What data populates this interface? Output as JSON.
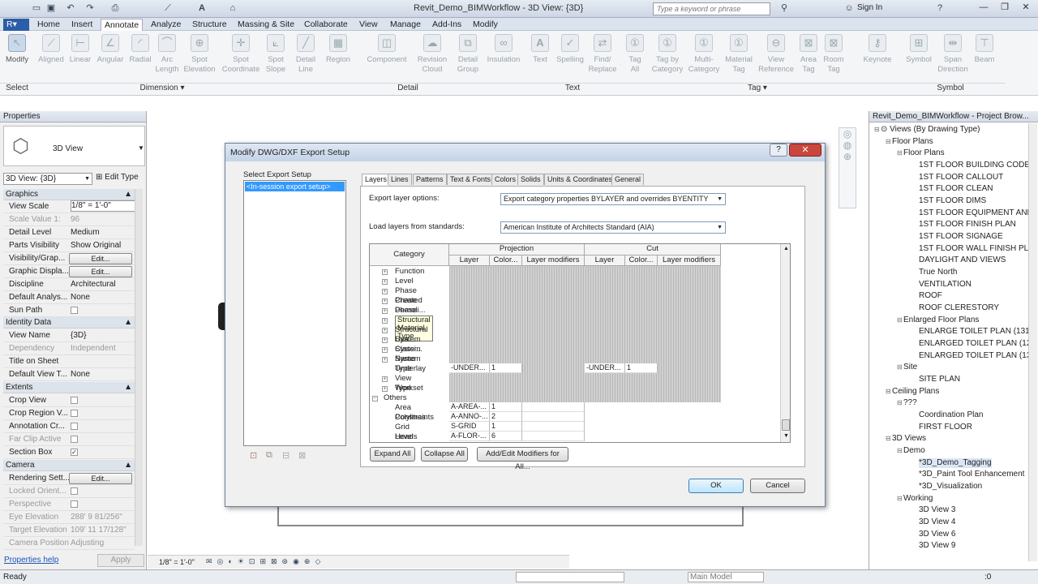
{
  "titlebar": {
    "title": "Revit_Demo_BIMWorkflow - 3D View: {3D}",
    "search_placeholder": "Type a keyword or phrase",
    "signin": "Sign In"
  },
  "tabs": [
    "Home",
    "Insert",
    "Annotate",
    "Analyze",
    "Structure",
    "Massing & Site",
    "Collaborate",
    "View",
    "Manage",
    "Add-Ins",
    "Modify"
  ],
  "active_tab": "Annotate",
  "ribbon": {
    "buttons": [
      "Modify",
      "Aligned",
      "Linear",
      "Angular",
      "Radial",
      "Arc Length",
      "Spot Elevation",
      "Spot Coordinate",
      "Spot Slope",
      "Detail Line",
      "Region",
      "Component",
      "Revision Cloud",
      "Detail Group",
      "Insulation",
      "Text",
      "Spelling",
      "Find/ Replace",
      "Tag All",
      "Tag by Category",
      "Multi- Category",
      "Material Tag",
      "View Reference",
      "Area Tag",
      "Room Tag",
      "Keynote",
      "Symbol",
      "Span Direction",
      "Beam"
    ],
    "groups": [
      "Select",
      "Dimension ▾",
      "Detail",
      "Text",
      "Tag ▾",
      "Symbol"
    ]
  },
  "properties": {
    "header": "Properties",
    "type_name": "3D View",
    "view_selector": "3D View: {3D}",
    "edit_type": "Edit Type",
    "sections": {
      "graphics": "Graphics",
      "identity": "Identity Data",
      "extents": "Extents",
      "camera": "Camera"
    },
    "rows": {
      "view_scale": [
        "View Scale",
        "1/8\" = 1'-0\""
      ],
      "scale_value": [
        "Scale Value   1:",
        "96"
      ],
      "detail_level": [
        "Detail Level",
        "Medium"
      ],
      "parts_visibility": [
        "Parts Visibility",
        "Show Original"
      ],
      "visibility": [
        "Visibility/Grap...",
        "Edit..."
      ],
      "graphic_display": [
        "Graphic Displa...",
        "Edit..."
      ],
      "discipline": [
        "Discipline",
        "Architectural"
      ],
      "default_analysis": [
        "Default Analys...",
        "None"
      ],
      "sun_path": [
        "Sun Path",
        ""
      ],
      "view_name": [
        "View Name",
        "{3D}"
      ],
      "dependency": [
        "Dependency",
        "Independent"
      ],
      "title_on_sheet": [
        "Title on Sheet",
        ""
      ],
      "default_view_template": [
        "Default View T...",
        "None"
      ],
      "crop_view": [
        "Crop View",
        ""
      ],
      "crop_region": [
        "Crop Region V...",
        ""
      ],
      "annotation_crop": [
        "Annotation Cr...",
        ""
      ],
      "far_clip": [
        "Far Clip Active",
        ""
      ],
      "section_box": [
        "Section Box",
        "✓"
      ],
      "rendering": [
        "Rendering Sett...",
        "Edit..."
      ],
      "locked_orient": [
        "Locked Orient...",
        ""
      ],
      "perspective": [
        "Perspective",
        ""
      ],
      "eye_elevation": [
        "Eye Elevation",
        "288' 9 81/256\""
      ],
      "target_elevation": [
        "Target Elevation",
        "109' 11 17/128\""
      ],
      "camera_position": [
        "Camera Position",
        "Adjusting"
      ]
    },
    "help": "Properties help",
    "apply": "Apply"
  },
  "browser": {
    "header": "Revit_Demo_BIMWorkflow - Project Brow...",
    "items": [
      "Views (By Drawing Type)",
      "Floor Plans",
      "Floor Plans",
      "1ST FLOOR BUILDING CODE",
      "1ST FLOOR CALLOUT",
      "1ST FLOOR CLEAN",
      "1ST FLOOR DIMS",
      "1ST FLOOR EQUIPMENT AND",
      "1ST FLOOR FINISH PLAN",
      "1ST FLOOR SIGNAGE",
      "1ST FLOOR WALL FINISH PLA",
      "DAYLIGHT AND VIEWS",
      "True North",
      "VENTILATION",
      "ROOF",
      "ROOF CLERESTORY",
      "Enlarged Floor Plans",
      "ENLARGE TOILET PLAN (131 &",
      "ENLARGED TOILET PLAN (12",
      "ENLARGED TOILET PLAN (13!",
      "Site",
      "SITE PLAN",
      "Ceiling Plans",
      "???",
      "Coordination Plan",
      "FIRST FLOOR",
      "3D Views",
      "Demo",
      "*3D_Demo_Tagging",
      "*3D_Paint Tool Enhancement",
      "*3D_Visualization",
      "Working",
      "3D View 3",
      "3D View 4",
      "3D View 6",
      "3D View 9"
    ]
  },
  "dialog": {
    "title": "Modify DWG/DXF Export Setup",
    "select_label": "Select Export Setup",
    "setups": [
      "<In-session export setup>"
    ],
    "tabs": [
      "Layers",
      "Lines",
      "Patterns",
      "Text & Fonts",
      "Colors",
      "Solids",
      "Units & Coordinates",
      "General"
    ],
    "export_layer_label": "Export layer options:",
    "export_layer_value": "Export category properties BYLAYER and overrides BYENTITY",
    "load_layers_label": "Load layers from standards:",
    "load_layers_value": "American Institute of Architects Standard (AIA)",
    "table": {
      "category": "Category",
      "projection": "Projection",
      "cut": "Cut",
      "cols": [
        "Layer",
        "Color...",
        "Layer modifiers",
        "Layer",
        "Color...",
        "Layer modifiers"
      ],
      "rows": [
        {
          "name": "Function",
          "expand": true
        },
        {
          "name": "Level",
          "expand": true
        },
        {
          "name": "Phase Created",
          "expand": true
        },
        {
          "name": "Phase Demoli...",
          "expand": true
        },
        {
          "name": "Phase Status",
          "expand": true
        },
        {
          "name": "Structural Material Type",
          "expand": true
        },
        {
          "name": "Structural Usa...",
          "expand": true
        },
        {
          "name": "System Classi...",
          "expand": true
        },
        {
          "name": "System Name",
          "expand": true
        },
        {
          "name": "System Type",
          "expand": true
        },
        {
          "name": "Underlay",
          "expand": false,
          "p_layer": "-UNDER...",
          "p_color": "1",
          "c_layer": "-UNDER...",
          "c_color": "1"
        },
        {
          "name": "View Type",
          "expand": true
        },
        {
          "name": "Workset",
          "expand": true
        }
      ],
      "others": "Others",
      "other_rows": [
        {
          "name": "Area Polylines",
          "layer": "A-AREA-...",
          "color": "1"
        },
        {
          "name": "Constraints",
          "layer": "A-ANNO-...",
          "color": "2"
        },
        {
          "name": "Grid Heads",
          "layer": "S-GRID",
          "color": "1"
        },
        {
          "name": "Level Heads",
          "layer": "A-FLOR-...",
          "color": "6"
        }
      ],
      "tooltip": "Structural Material Type"
    },
    "expand_all": "Expand All",
    "collapse_all": "Collapse All",
    "add_edit": "Add/Edit Modifiers for All...",
    "ok": "OK",
    "cancel": "Cancel"
  },
  "viewbar": {
    "scale": "1/8\" = 1'-0\""
  },
  "status": {
    "text": "Ready",
    "model": "Main Model",
    "count": ":0"
  }
}
